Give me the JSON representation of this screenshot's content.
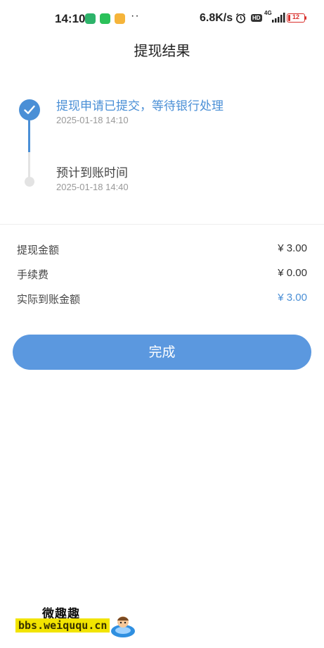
{
  "status_bar": {
    "time": "14:10",
    "dots": "··",
    "net_speed": "6.8K/s",
    "hd": "HD",
    "network": "4G",
    "battery": "12"
  },
  "page": {
    "title": "提现结果"
  },
  "steps": [
    {
      "title": "提现申请已提交，等待银行处理",
      "time": "2025-01-18 14:10",
      "state": "done"
    },
    {
      "title": "预计到账时间",
      "time": "2025-01-18 14:40",
      "state": "pending"
    }
  ],
  "details": [
    {
      "label": "提现金额",
      "value": "¥ 3.00"
    },
    {
      "label": "手续费",
      "value": "¥ 0.00"
    },
    {
      "label": "实际到账金额",
      "value": "¥ 3.00"
    }
  ],
  "actions": {
    "done_label": "完成"
  },
  "watermark": {
    "name": "微趣趣",
    "url": "bbs.weiququ.cn"
  },
  "colors": {
    "accent": "#4a8fd6",
    "button": "#5b98df",
    "muted": "#999999",
    "battery_low": "#d9302c"
  }
}
